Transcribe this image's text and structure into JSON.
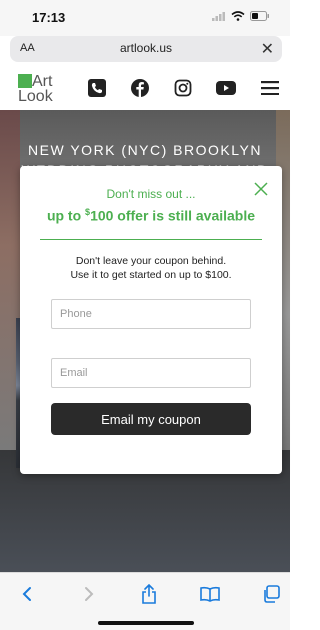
{
  "status_bar": {
    "time": "17:13"
  },
  "browser": {
    "aa_label": "AA",
    "url": "artlook.us",
    "close_label": "✕"
  },
  "site": {
    "logo_line1": "Art",
    "logo_line2": "Look",
    "hero_title_line1": "NEW YORK (NYC) BROOKLYN",
    "hero_title_line2": "WEDDING PHOTOGRAPHY AND"
  },
  "modal": {
    "kicker": "Don't miss out ...",
    "headline_prefix": "up to ",
    "headline_currency": "$",
    "headline_rest": "100 offer is still available",
    "body_line1": "Don't leave your coupon behind.",
    "body_line2": "Use it to get started on up to $100.",
    "phone_placeholder": "Phone",
    "email_placeholder": "Email",
    "button_label": "Email my coupon"
  },
  "colors": {
    "accent": "#4caf50",
    "button": "#2a2a2a",
    "ios_blue": "#1a7bdc"
  },
  "icons": {
    "nav": [
      "phone-icon",
      "facebook-icon",
      "instagram-icon",
      "youtube-icon",
      "menu-icon"
    ],
    "toolbar": [
      "back-icon",
      "forward-icon",
      "share-icon",
      "bookmarks-icon",
      "tabs-icon"
    ]
  }
}
